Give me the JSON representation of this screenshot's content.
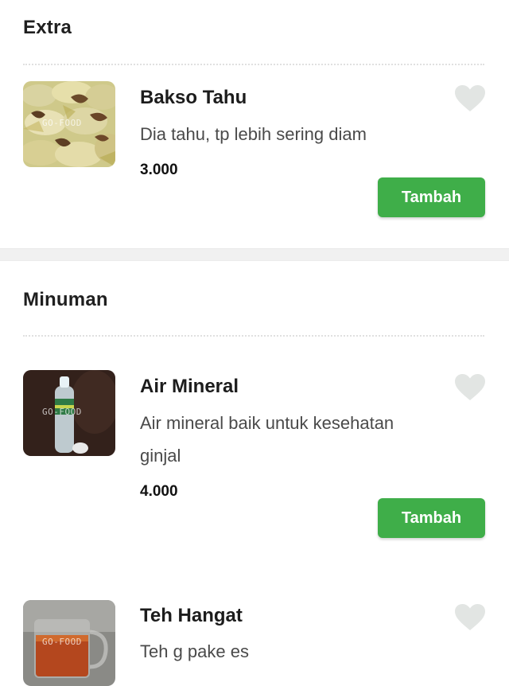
{
  "sections": [
    {
      "title": "Extra",
      "items": [
        {
          "name": "Bakso Tahu",
          "description": "Dia tahu, tp lebih sering diam",
          "price": "3.000",
          "button_label": "Tambah",
          "image_watermark": "GO-FOOD",
          "icon": "heart-icon"
        }
      ]
    },
    {
      "title": "Minuman",
      "items": [
        {
          "name": "Air Mineral",
          "description": "Air mineral baik untuk kesehatan ginjal",
          "price": "4.000",
          "button_label": "Tambah",
          "image_watermark": "GO-FOOD",
          "icon": "heart-icon"
        },
        {
          "name": "Teh Hangat",
          "description": "Teh g pake es",
          "image_watermark": "GO-FOOD",
          "icon": "heart-icon"
        }
      ]
    }
  ],
  "colors": {
    "accent_green": "#3fae49",
    "heart_gray": "#e2e5e3",
    "divider": "#f1f1f1"
  }
}
